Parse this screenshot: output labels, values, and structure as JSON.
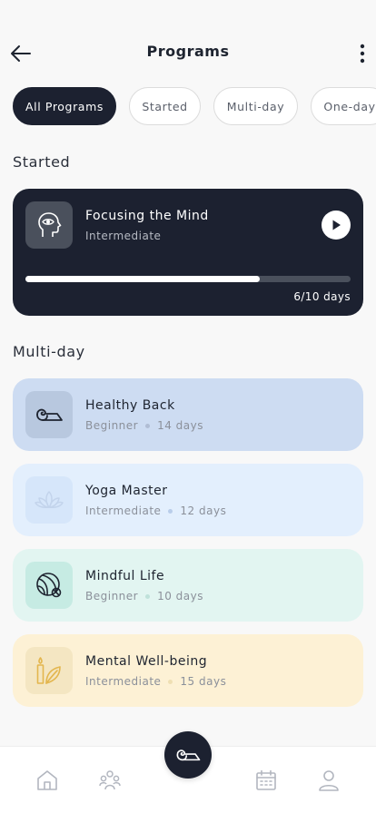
{
  "header": {
    "title": "Programs"
  },
  "filters": [
    "All Programs",
    "Started",
    "Multi-day",
    "One-day"
  ],
  "sections": {
    "started": "Started",
    "multiday": "Multi-day"
  },
  "started_program": {
    "name": "Focusing the Mind",
    "level": "Intermediate",
    "progress": 0.72,
    "days_label": "6/10 days"
  },
  "programs": [
    {
      "name": "Healthy Back",
      "level": "Beginner",
      "duration": "14 days",
      "icon": "yoga-mat-icon",
      "bg": "#cddcf2",
      "icon_bg": "#b8c8df",
      "icon_color": "#1e2430",
      "dot": "#b0bdd4"
    },
    {
      "name": "Yoga Master",
      "level": "Intermediate",
      "duration": "12 days",
      "icon": "lotus-icon",
      "bg": "#e3effd",
      "icon_bg": "#d6e6fa",
      "icon_color": "#c3d4ec",
      "dot": "#b9cdea"
    },
    {
      "name": "Mindful Life",
      "level": "Beginner",
      "duration": "10 days",
      "icon": "yoga-ball-icon",
      "bg": "#e2f5f1",
      "icon_bg": "#c6ebe3",
      "icon_color": "#1e2430",
      "dot": "#bfe2da"
    },
    {
      "name": "Mental Well-being",
      "level": "Intermediate",
      "duration": "15 days",
      "icon": "candle-leaf-icon",
      "bg": "#fdf1d5",
      "icon_bg": "#f4e6c2",
      "icon_color": "#e3b64e",
      "dot": "#efdfb3"
    }
  ],
  "nav": [
    "home-icon",
    "community-icon",
    "practice-icon",
    "calendar-icon",
    "profile-icon"
  ]
}
